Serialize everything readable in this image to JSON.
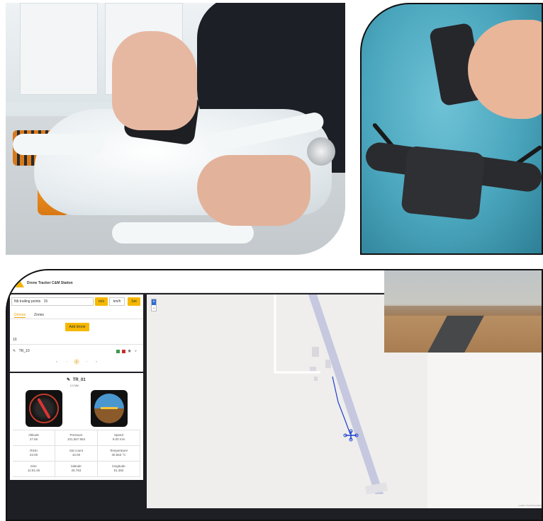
{
  "app": {
    "title": "Drone Tracker C&M Station"
  },
  "top_panel": {
    "nb_points_label": "Nb trailing points",
    "nb_points_value": "15",
    "unit_ms": "m/s",
    "unit_kmh": "km/h",
    "set_label": "Set",
    "tabs": [
      {
        "label": "Drones",
        "active": true
      },
      {
        "label": "Zones",
        "active": false
      }
    ],
    "add_drone_label": "Add drone",
    "search_value": "10",
    "drone_item_label": "TR_10",
    "pager": [
      "«",
      "‹",
      "1",
      "›",
      "»"
    ],
    "pager_active": "1"
  },
  "drone_panel": {
    "name": "TR_01",
    "subtitle": "0.0 MM",
    "stats": [
      {
        "label": "Altitude",
        "value": "27.65"
      },
      {
        "label": "Pressure",
        "value": "101,067.953"
      },
      {
        "label": "Speed",
        "value": "9.00 m/s"
      },
      {
        "label": "RSSI",
        "value": "23.00"
      },
      {
        "label": "Sat count",
        "value": "10.00"
      },
      {
        "label": "Temperature",
        "value": "30.563 °C"
      },
      {
        "label": "time",
        "value": "11:51:45"
      },
      {
        "label": "latitude",
        "value": "25.763"
      },
      {
        "label": "longitude",
        "value": "51.382"
      }
    ]
  },
  "map": {
    "zoom_in": "+",
    "zoom_out": "−",
    "attribution": "Leaflet | OpenStreetMap"
  },
  "icons": {
    "edit": "pencil-icon",
    "locate": "target-icon",
    "delete": "trash-icon",
    "visibility": "eye-icon",
    "zoom": "magnifier-icon"
  },
  "colors": {
    "accent": "#f5b800",
    "track": "#1a3fd1",
    "runway": "#c6c8e0"
  }
}
